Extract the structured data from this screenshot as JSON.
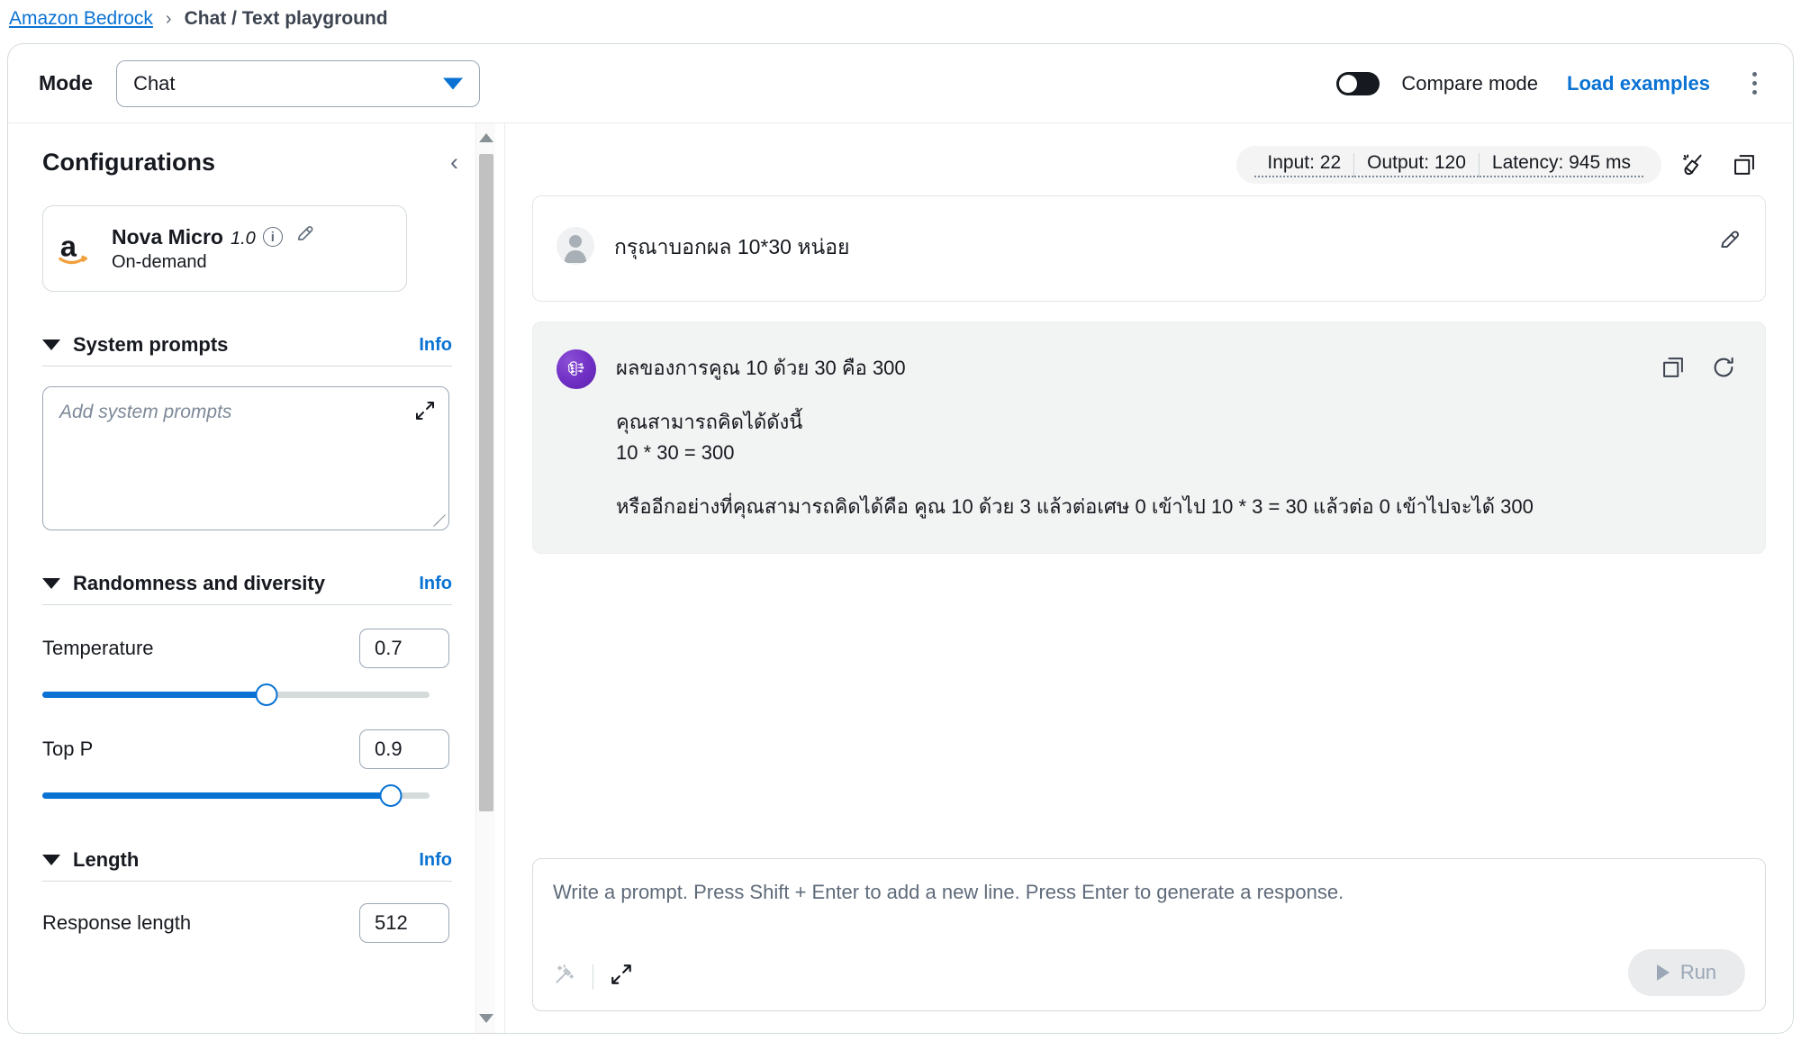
{
  "breadcrumb": {
    "root_label": "Amazon Bedrock",
    "separator": "›",
    "current_label": "Chat / Text playground"
  },
  "mode_bar": {
    "label": "Mode",
    "selected_value": "Chat",
    "options": [
      "Chat"
    ],
    "compare_mode_label": "Compare mode",
    "compare_mode_enabled": false,
    "load_examples_label": "Load examples",
    "more_options_icon": "kebab-menu-icon"
  },
  "sidebar": {
    "title": "Configurations",
    "collapse_icon": "chevron-left-icon",
    "model": {
      "provider_icon": "amazon-logo-icon",
      "name": "Nova Micro",
      "version": "1.0",
      "info_icon": "info-circle-icon",
      "edit_icon": "pencil-icon",
      "availability": "On-demand"
    },
    "sections": [
      {
        "title": "System prompts",
        "info_label": "Info",
        "expanded": true,
        "placeholder": "Add system prompts",
        "value": "",
        "expand_icon": "expand-arrows-icon"
      },
      {
        "title": "Randomness and diversity",
        "info_label": "Info",
        "expanded": true,
        "params": [
          {
            "label": "Temperature",
            "value": "0.7",
            "fill_percent": 58
          },
          {
            "label": "Top P",
            "value": "0.9",
            "fill_percent": 90
          }
        ]
      },
      {
        "title": "Length",
        "info_label": "Info",
        "expanded": true,
        "params": [
          {
            "label": "Response length",
            "value": "512"
          }
        ]
      }
    ]
  },
  "main": {
    "metrics": [
      {
        "label": "Input: 22"
      },
      {
        "label": "Output: 120"
      },
      {
        "label": "Latency: 945 ms"
      }
    ],
    "clear_icon": "broom-icon",
    "copy_icon": "copy-icon",
    "conversation": [
      {
        "role": "user",
        "avatar_icon": "user-avatar-icon",
        "text": "กรุณาบอกผล 10*30 หน่อย",
        "edit_icon": "pencil-icon"
      },
      {
        "role": "assistant",
        "avatar_icon": "ai-brain-icon",
        "lines": [
          "ผลของการคูณ 10 ด้วย 30 คือ 300",
          "คุณสามารถคิดได้ดังนี้",
          "10 * 30 = 300",
          "หรืออีกอย่างที่คุณสามารถคิดได้คือ คูณ 10 ด้วย 3 แล้วต่อเศษ 0 เข้าไป 10 * 3 = 30 แล้วต่อ 0 เข้าไปจะได้ 300"
        ],
        "copy_icon": "copy-icon",
        "regenerate_icon": "refresh-icon"
      }
    ],
    "prompt": {
      "placeholder": "Write a prompt. Press Shift + Enter to add a new line. Press Enter to generate a response.",
      "value": "",
      "optimize_icon": "magic-wand-icon",
      "expand_icon": "expand-arrows-icon",
      "run_label": "Run",
      "run_enabled": false,
      "run_icon": "play-icon"
    }
  },
  "colors": {
    "link": "#0972d3",
    "accent": "#0972d3",
    "ai_avatar": "#6f2fc4",
    "bubble_bg": "#f2f3f3"
  }
}
